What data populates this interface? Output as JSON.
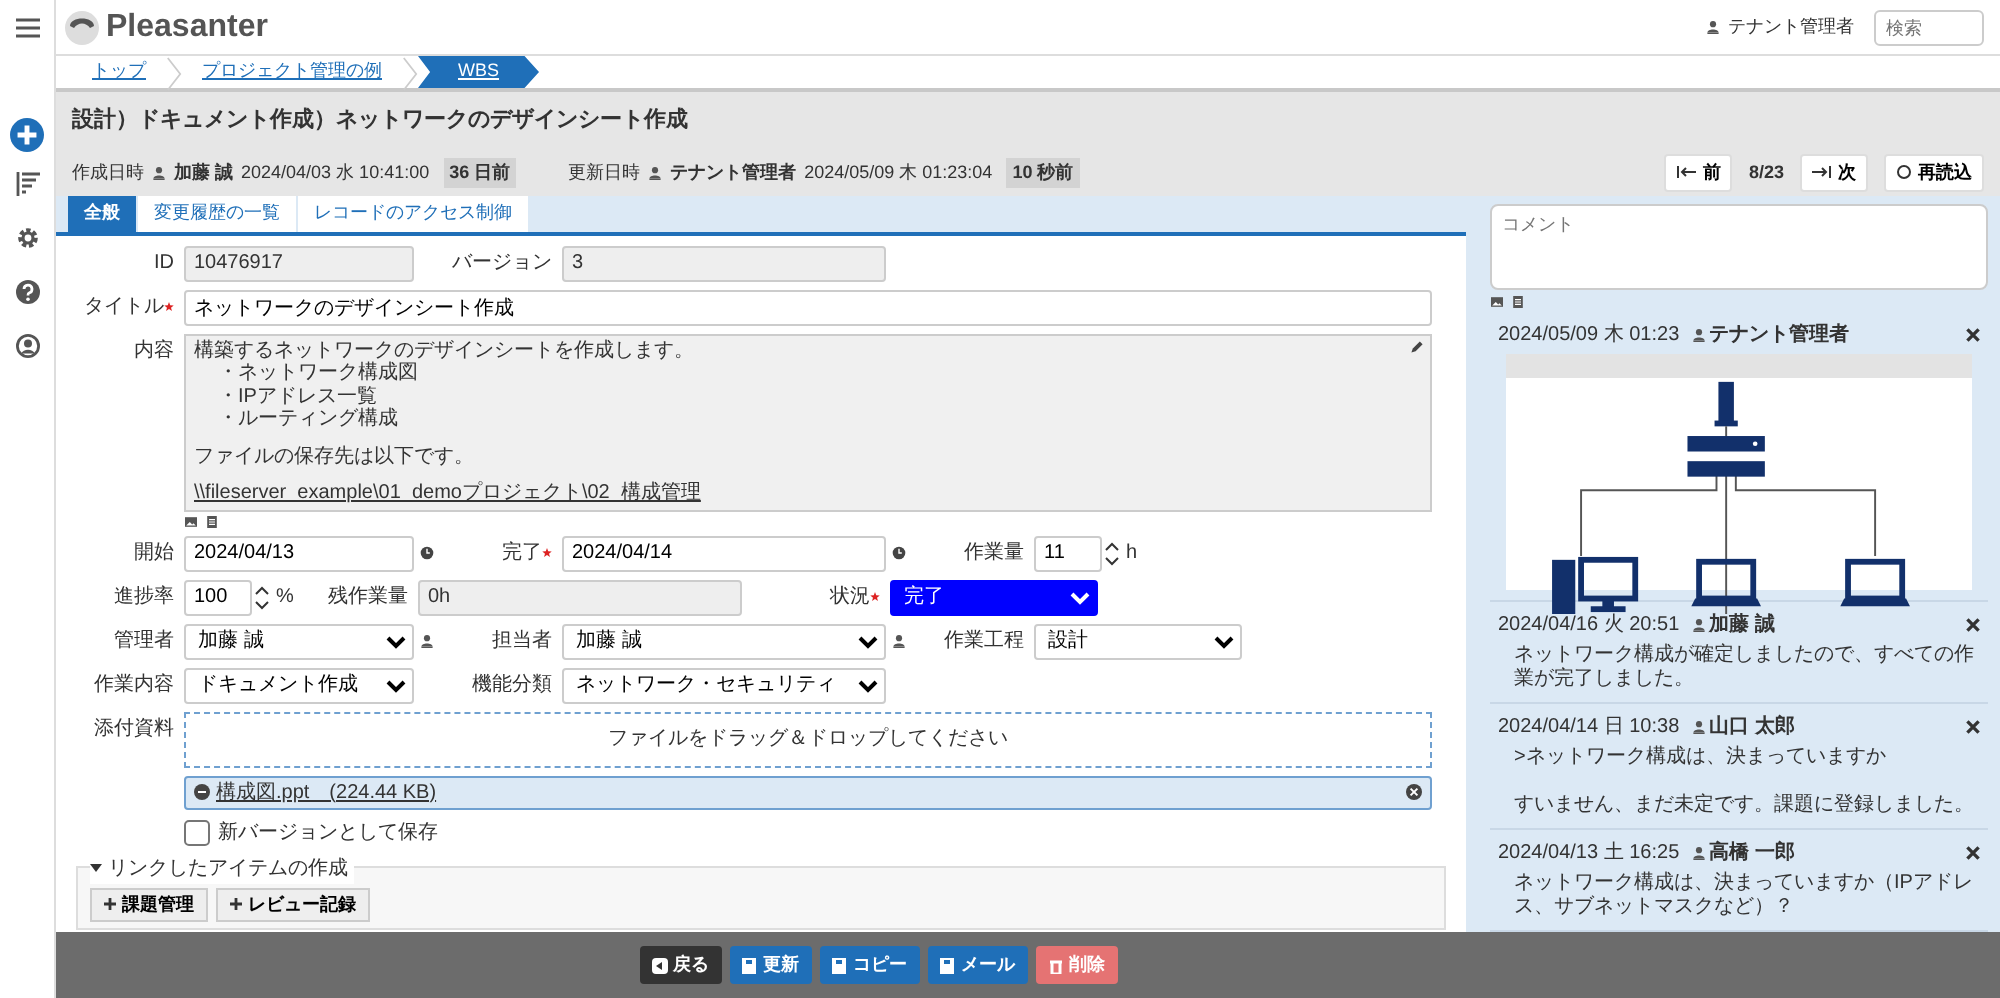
{
  "header": {
    "logo": "Pleasanter",
    "user": "テナント管理者",
    "search": {
      "placeholder": "検索"
    }
  },
  "breadcrumb": [
    {
      "label": "トップ",
      "selected": false
    },
    {
      "label": "プロジェクト管理の例",
      "selected": false
    },
    {
      "label": "WBS",
      "selected": true
    }
  ],
  "record": {
    "title": "設計）ドキュメント作成）ネットワークのデザインシート作成",
    "meta": [
      {
        "label": "作成日時",
        "user": "加藤 誠",
        "time": "2024/04/03 水 10:41:00",
        "ago": "36 日前"
      },
      {
        "label": "更新日時",
        "user": "テナント管理者",
        "time": "2024/05/09 木 01:23:04",
        "ago": "10 秒前"
      }
    ]
  },
  "pager": {
    "prev": "前",
    "position": "8/23",
    "next": "次",
    "reload": "再読込"
  },
  "tabs": [
    {
      "label": "全般",
      "selected": true
    },
    {
      "label": "変更履歴の一覧",
      "selected": false
    },
    {
      "label": "レコードのアクセス制御",
      "selected": false
    }
  ],
  "form_rows": [
    [
      {
        "label": "ID",
        "kind": "readonly",
        "value": "10476917",
        "required": false
      },
      {
        "label": "バージョン",
        "kind": "readonly",
        "value": "3",
        "required": false
      }
    ],
    [
      {
        "label": "タイトル",
        "kind": "text",
        "value": "ネットワークのデザインシート作成",
        "required": true
      }
    ],
    [
      {
        "label": "内容",
        "kind": "textarea",
        "required": false,
        "blocks": [
          {
            "kind": "text",
            "text": "構築するネットワークのデザインシートを作成します。"
          },
          {
            "kind": "bullet",
            "text": "・ネットワーク構成図"
          },
          {
            "kind": "bullet",
            "text": "・IPアドレス一覧"
          },
          {
            "kind": "bullet",
            "text": "・ルーティング構成"
          },
          {
            "kind": "spaced",
            "text": "ファイルの保存先は以下です。"
          },
          {
            "kind": "link",
            "text": "\\\\fileserver_example\\01_demoプロジェクト\\02_構成管理"
          }
        ]
      }
    ],
    [
      {
        "label": "開始",
        "kind": "date",
        "value": "2024/04/13",
        "required": false
      },
      {
        "label": "完了",
        "kind": "date",
        "value": "2024/04/14",
        "required": true
      },
      {
        "label": "作業量",
        "kind": "spin",
        "value": "11",
        "unit": "h",
        "required": false
      }
    ],
    [
      {
        "label": "進捗率",
        "kind": "spin",
        "value": "100",
        "unit": "%",
        "required": false
      },
      {
        "label": "残作業量",
        "kind": "readonly",
        "value": "0h",
        "required": false
      },
      {
        "label": "状況",
        "kind": "status",
        "value": "完了",
        "required": true
      }
    ],
    [
      {
        "label": "管理者",
        "kind": "user",
        "value": "加藤 誠",
        "required": false
      },
      {
        "label": "担当者",
        "kind": "user",
        "value": "加藤 誠",
        "required": false
      },
      {
        "label": "作業工程",
        "kind": "select",
        "value": "設計",
        "required": false
      }
    ],
    [
      {
        "label": "作業内容",
        "kind": "select",
        "value": "ドキュメント作成",
        "required": false
      },
      {
        "label": "機能分類",
        "kind": "select",
        "value": "ネットワーク・セキュリティ",
        "required": false
      }
    ]
  ],
  "attachments": {
    "label": "添付資料",
    "dropzone": "ファイルをドラッグ＆ドロップしてください",
    "files": [
      {
        "name": "構成図.ppt　(224.44 KB)"
      }
    ],
    "new_version": {
      "label": "新バージョンとして保存",
      "checked": false
    }
  },
  "linked": {
    "legend": "リンクしたアイテムの作成",
    "expanded": true,
    "buttons": [
      "課題管理",
      "レビュー記録"
    ]
  },
  "comments": {
    "placeholder": "コメント",
    "items": [
      {
        "time": "2024/05/09 木 01:23",
        "user": "テナント管理者",
        "kind": "image"
      },
      {
        "time": "2024/04/16 火 20:51",
        "user": "加藤 誠",
        "kind": "text",
        "paragraphs": [
          "ネットワーク構成が確定しましたので、すべての作業が完了しました。"
        ]
      },
      {
        "time": "2024/04/14 日 10:38",
        "user": "山口 太郎",
        "kind": "text",
        "paragraphs": [
          ">ネットワーク構成は、決まっていますか",
          "すいません、まだ未定です。課題に登録しました。"
        ]
      },
      {
        "time": "2024/04/13 土 16:25",
        "user": "高橋 一郎",
        "kind": "text",
        "paragraphs": [
          "ネットワーク構成は、決まっていますか（IPアドレス、サブネットマスクなど）？"
        ]
      }
    ]
  },
  "footer": [
    {
      "label": "戻る",
      "kind": "back"
    },
    {
      "label": "更新",
      "kind": "primary"
    },
    {
      "label": "コピー",
      "kind": "primary"
    },
    {
      "label": "メール",
      "kind": "primary"
    },
    {
      "label": "削除",
      "kind": "danger"
    }
  ]
}
